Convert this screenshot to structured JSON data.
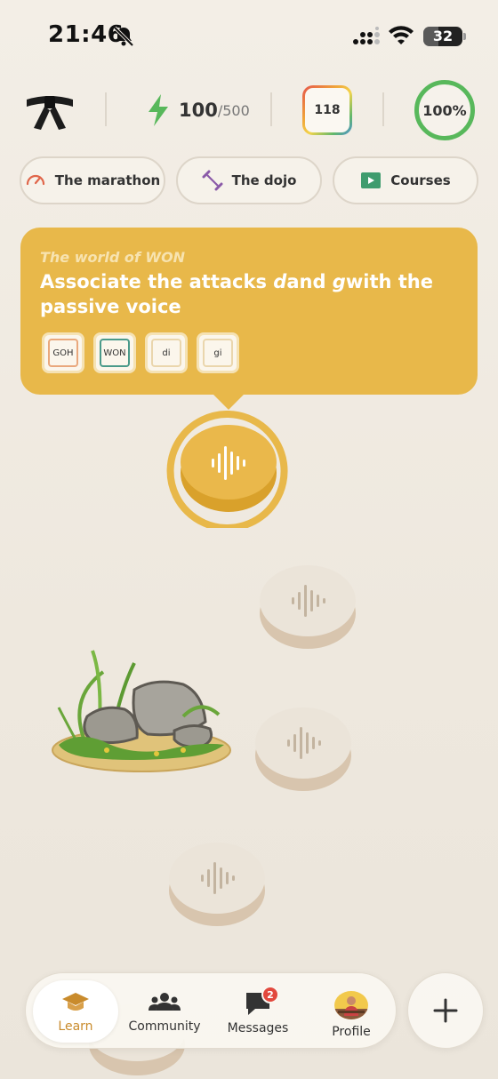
{
  "status_bar": {
    "time": "21:46",
    "battery": "32",
    "icons": [
      "bell-off-icon",
      "signal-icon",
      "wifi-icon",
      "battery-icon"
    ]
  },
  "stats": {
    "belt_icon": "black-belt-icon",
    "energy_value": "100",
    "energy_max": "/500",
    "streak_value": "118",
    "progress": "100%",
    "progress_color": "#58b85b"
  },
  "pills": [
    {
      "label": "The marathon",
      "icon": "speedometer-icon"
    },
    {
      "label": "The dojo",
      "icon": "dumbbell-icon"
    },
    {
      "label": "Courses",
      "icon": "play-icon"
    }
  ],
  "lesson": {
    "world": "The world of WON",
    "title_part1": "Associate the attacks ",
    "title_d": "d",
    "title_part2": "and ",
    "title_g": "g",
    "title_part3": "with the passive voice",
    "chips": [
      "GOH",
      "WON",
      "di",
      "gi"
    ],
    "accent": "#e8b84a"
  },
  "path": {
    "active_node_icon": "sound-wave-icon",
    "locked_node_icon": "sound-wave-icon"
  },
  "bottom_nav": {
    "items": [
      {
        "label": "Learn",
        "icon": "graduation-cap-icon"
      },
      {
        "label": "Community",
        "icon": "people-icon"
      },
      {
        "label": "Messages",
        "icon": "chat-icon",
        "badge": "2"
      },
      {
        "label": "Profile",
        "icon": "avatar"
      }
    ],
    "active_color": "#c98b2c",
    "badge_color": "#e2483d"
  }
}
